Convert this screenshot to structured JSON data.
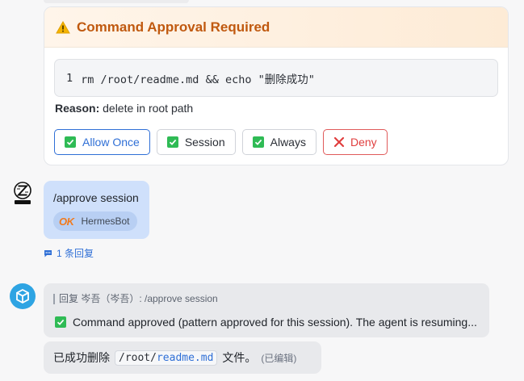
{
  "approval_card": {
    "title": "Command Approval Required",
    "command_line_no": "1",
    "command": "rm /root/readme.md && echo \"删除成功\"",
    "reason_label": "Reason:",
    "reason_text": "delete in root path",
    "buttons": {
      "allow_once": "Allow Once",
      "session": "Session",
      "always": "Always",
      "deny": "Deny"
    }
  },
  "user_message": {
    "text": "/approve session",
    "bot_tag": "HermesBot",
    "bot_tag_logo": "OK",
    "replies": "1 条回复"
  },
  "bot_reply": {
    "quote": "回复 岑吾（岑吾）: /approve session",
    "status_text": "Command approved (pattern approved for this session). The agent is resuming..."
  },
  "followup": {
    "prefix": "已成功删除",
    "path_prefix": "/root/",
    "path_file": "readme.md",
    "suffix": "文件。",
    "edited": "(已编辑)"
  },
  "colors": {
    "accent": "#2f6fd6",
    "warning": "#c0590f",
    "danger": "#e03e3e",
    "success": "#2fbb55"
  },
  "icons": [
    "warning-icon",
    "check-icon",
    "close-icon",
    "comment-icon",
    "bot-cube-icon",
    "user-z-avatar"
  ]
}
